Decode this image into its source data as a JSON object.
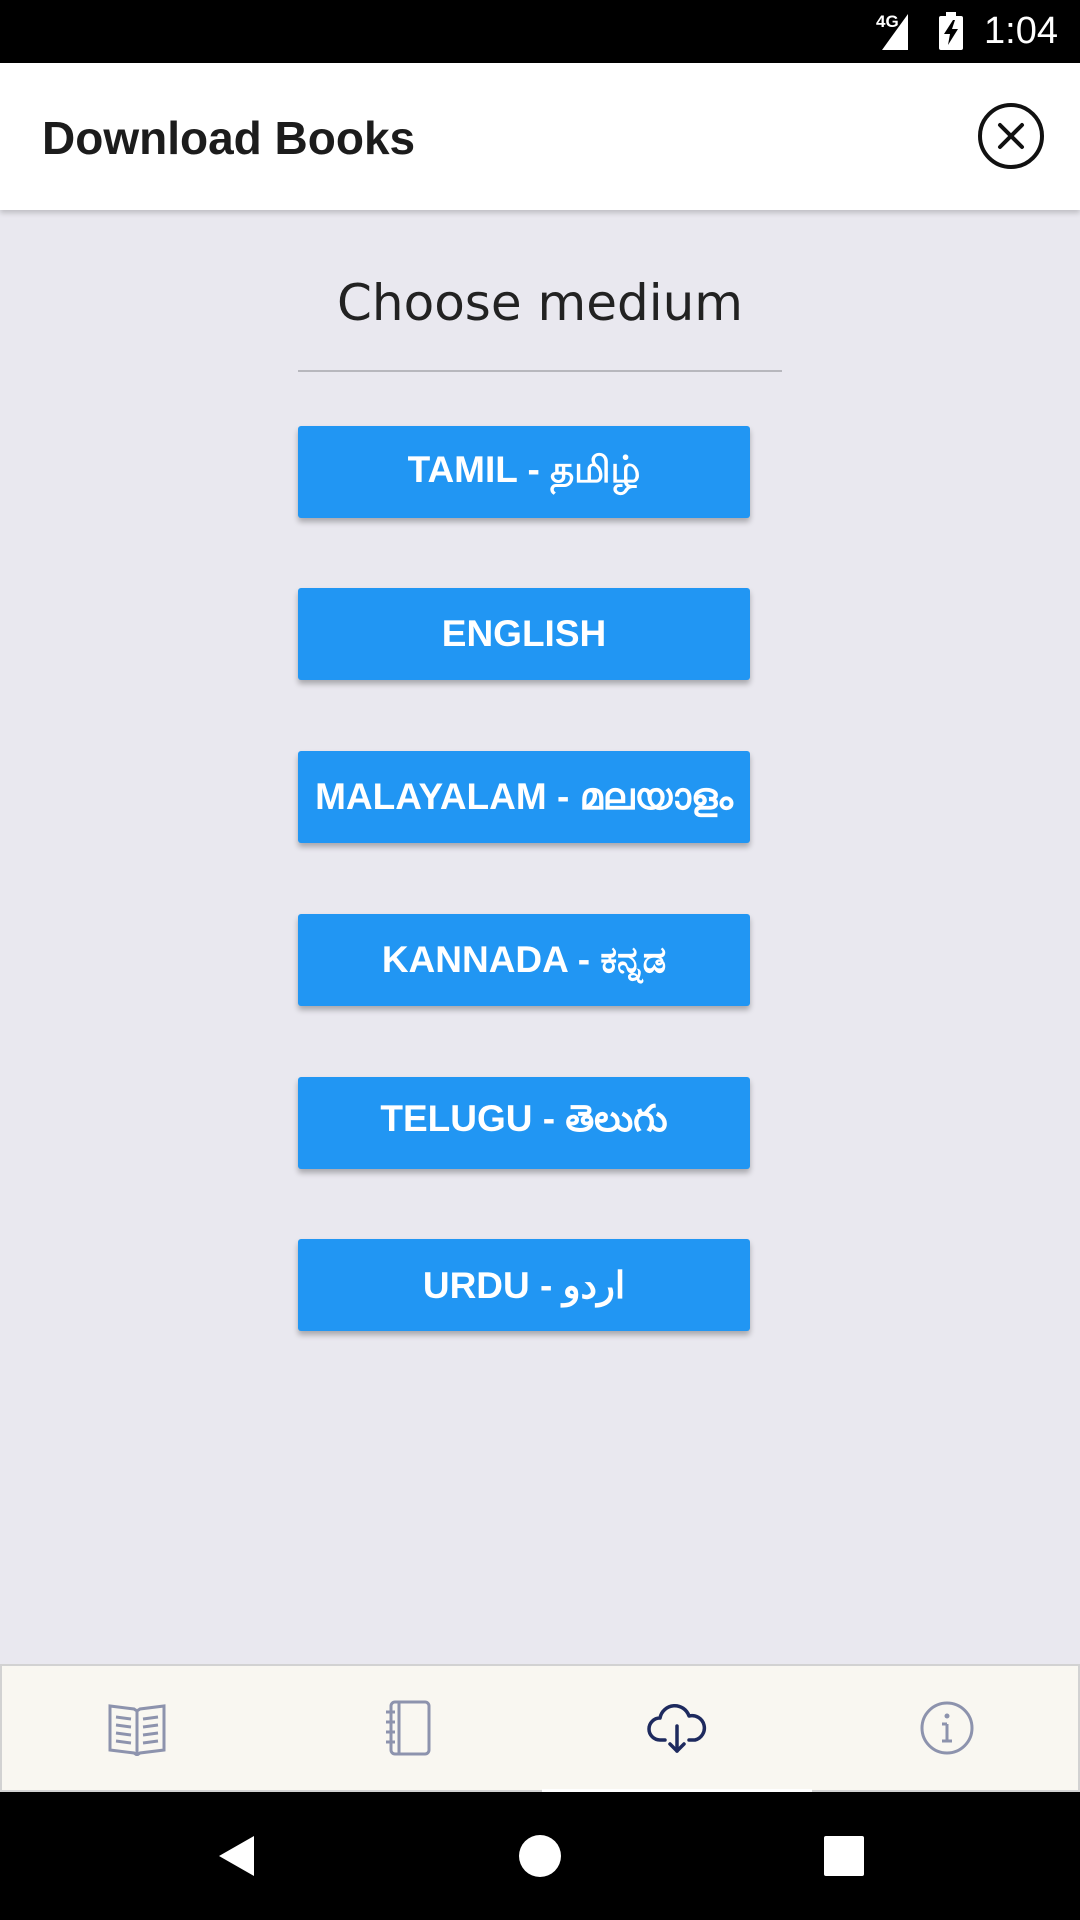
{
  "status_bar": {
    "network": "4G",
    "time": "1:04",
    "icons": [
      "signal-icon",
      "battery-charging-icon"
    ]
  },
  "app_bar": {
    "title": "Download Books",
    "close_icon": "close-circle-icon"
  },
  "main": {
    "heading": "Choose medium",
    "mediums": [
      {
        "label": "TAMIL - தமிழ்"
      },
      {
        "label": "ENGLISH"
      },
      {
        "label": "MALAYALAM - മലയാളം"
      },
      {
        "label": "KANNADA - ಕನ್ನಡ"
      },
      {
        "label": "TELUGU - తెలుగు"
      },
      {
        "label": "URDU - اردو"
      }
    ]
  },
  "bottom_nav": {
    "items": [
      {
        "icon": "open-book-icon",
        "active": false
      },
      {
        "icon": "notebook-icon",
        "active": false
      },
      {
        "icon": "cloud-download-icon",
        "active": true
      },
      {
        "icon": "info-icon",
        "active": false
      }
    ]
  },
  "system_nav": {
    "icons": [
      "back-icon",
      "home-icon",
      "recents-icon"
    ]
  },
  "colors": {
    "button_blue": "#2196f3",
    "background": "#e9e8ef",
    "nav_background": "#f9f7f1",
    "inactive_icon": "#8d93ad",
    "active_icon": "#1e2a5e"
  }
}
